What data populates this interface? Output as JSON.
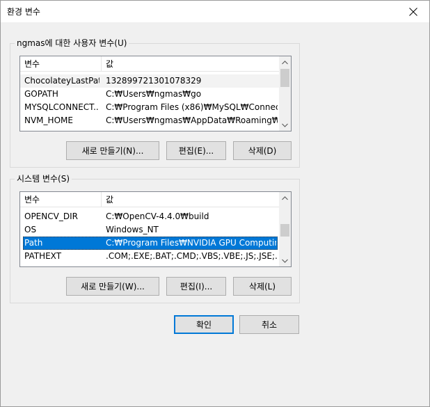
{
  "window": {
    "title": "환경 변수"
  },
  "user_group": {
    "title": "ngmas에 대한 사용자 변수(U)",
    "columns": [
      "변수",
      "값"
    ],
    "rows": [
      {
        "name": "ChocolateyLastPat...",
        "value": "132899721301078329"
      },
      {
        "name": "GOPATH",
        "value": "C:₩Users₩ngmas₩go"
      },
      {
        "name": "MYSQLCONNECT...",
        "value": "C:₩Program Files (x86)₩MySQL₩Connecto..."
      },
      {
        "name": "NVM_HOME",
        "value": "C:₩Users₩ngmas₩AppData₩Roaming₩nvm"
      }
    ],
    "buttons": {
      "new": "새로 만들기(N)...",
      "edit": "편집(E)...",
      "delete": "삭제(D)"
    }
  },
  "system_group": {
    "title": "시스템 변수(S)",
    "columns": [
      "변수",
      "값"
    ],
    "rows": [
      {
        "name": "OPENCV_DIR",
        "value": "C:₩OpenCV-4.4.0₩build"
      },
      {
        "name": "OS",
        "value": "Windows_NT"
      },
      {
        "name": "Path",
        "value": "C:₩Program Files₩NVIDIA GPU Computing..."
      },
      {
        "name": "PATHEXT",
        "value": ".COM;.EXE;.BAT;.CMD;.VBS;.VBE;.JS;.JSE;.W..."
      }
    ],
    "selected_index": 2,
    "buttons": {
      "new": "새로 만들기(W)...",
      "edit": "편집(I)...",
      "delete": "삭제(L)"
    }
  },
  "footer": {
    "ok": "확인",
    "cancel": "취소"
  },
  "icons": {
    "close": "close-icon",
    "scroll_up": "chevron-up-icon",
    "scroll_down": "chevron-down-icon"
  },
  "colors": {
    "selection": "#0078d7",
    "default_button_border": "#0078d7"
  }
}
